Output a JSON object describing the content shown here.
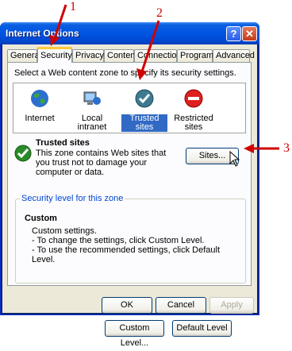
{
  "window": {
    "title": "Internet Options"
  },
  "tabs": [
    "General",
    "Security",
    "Privacy",
    "Content",
    "Connections",
    "Programs",
    "Advanced"
  ],
  "active_tab": "Security",
  "zone_prompt": "Select a Web content zone to specify its security settings.",
  "zones": [
    {
      "label": "Internet",
      "icon": "globe-icon"
    },
    {
      "label": "Local intranet",
      "icon": "computer-globe-icon"
    },
    {
      "label": "Trusted sites",
      "icon": "checkmark-circle-icon",
      "selected": true
    },
    {
      "label": "Restricted sites",
      "icon": "no-entry-icon"
    }
  ],
  "zone_info": {
    "title": "Trusted sites",
    "description": "This zone contains Web sites that you trust not to damage your computer or data.",
    "sites_button": "Sites..."
  },
  "security_level": {
    "group_title": "Security level for this zone",
    "level_name": "Custom",
    "line1": "Custom settings.",
    "line2": "- To change the settings, click Custom Level.",
    "line3": "- To use the recommended settings, click Default Level.",
    "custom_button": "Custom Level...",
    "default_button": "Default Level"
  },
  "dialog_buttons": {
    "ok": "OK",
    "cancel": "Cancel",
    "apply": "Apply"
  },
  "annotations": [
    "1",
    "2",
    "3"
  ],
  "colors": {
    "arrow": "#d00000",
    "selection": "#316ac5",
    "titlebar": "#0054e3"
  }
}
